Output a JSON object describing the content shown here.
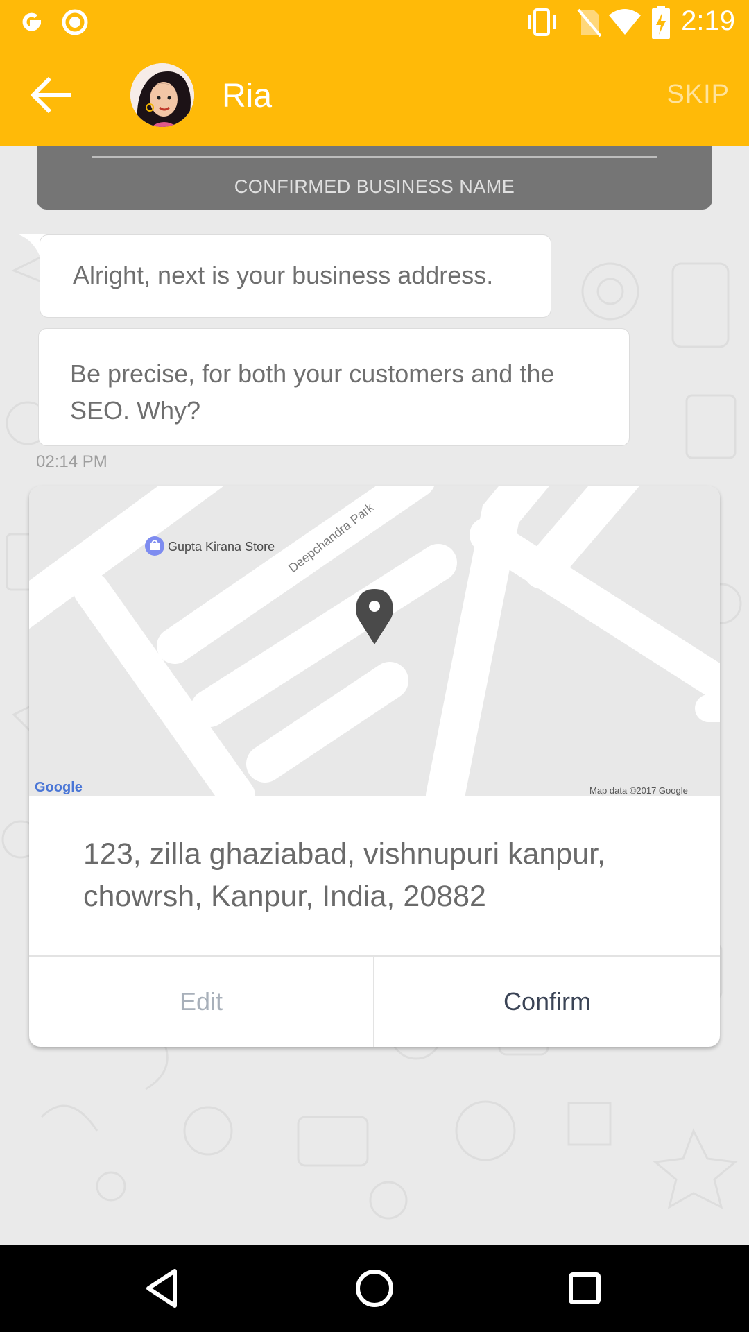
{
  "status_bar": {
    "time": "2:19",
    "icons": [
      "google-icon",
      "record-icon",
      "vibrate-icon",
      "no-sim-icon",
      "wifi-icon",
      "battery-charging-icon"
    ]
  },
  "app_bar": {
    "title": "Ria",
    "skip_label": "SKIP",
    "back_icon": "arrow-left-icon",
    "avatar": "avatar"
  },
  "chat": {
    "confirmed_label": "CONFIRMED BUSINESS NAME",
    "messages": [
      {
        "text": "Alright, next is your business address."
      },
      {
        "text": "Be precise, for both your customers and the SEO. Why?"
      }
    ],
    "timestamp": "02:14 PM"
  },
  "location_card": {
    "map": {
      "poi_label": "Gupta Kirana Store",
      "street_label": "Deepchandra Park",
      "google_logo": "Google",
      "attribution": "Map data ©2017 Google"
    },
    "address": "123, zilla ghaziabad, vishnupuri kanpur, chowrsh, Kanpur, India, 20882",
    "edit_label": "Edit",
    "confirm_label": "Confirm"
  },
  "nav_bar": {
    "icons": [
      "back-triangle-icon",
      "home-circle-icon",
      "recents-square-icon"
    ]
  }
}
